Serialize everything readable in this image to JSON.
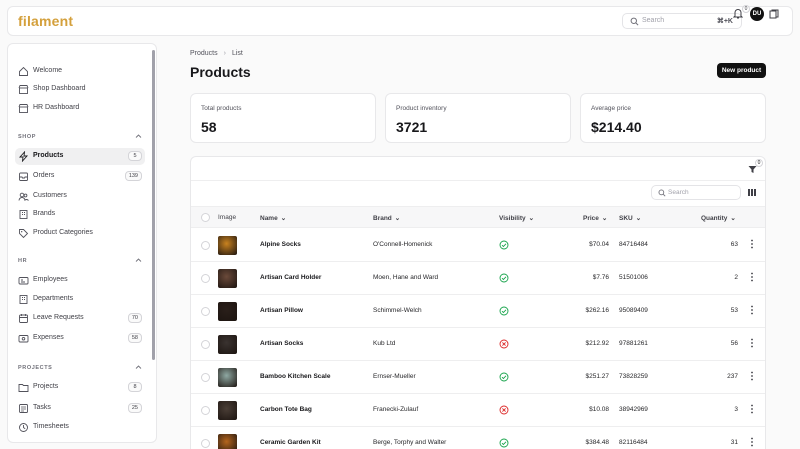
{
  "app": {
    "logo": "filament"
  },
  "topbar": {
    "search_placeholder": "Search",
    "search_shortcut": "⌘+K",
    "notifications_count": "0",
    "avatar_initials": "DU"
  },
  "sidebar": {
    "top_items": [
      {
        "label": "Welcome",
        "icon": "home-icon"
      },
      {
        "label": "Shop Dashboard",
        "icon": "shop-icon"
      },
      {
        "label": "HR Dashboard",
        "icon": "shop-icon"
      }
    ],
    "groups": [
      {
        "label": "SHOP",
        "items": [
          {
            "label": "Products",
            "count": "5",
            "active": true,
            "icon": "bolt-icon"
          },
          {
            "label": "Orders",
            "count": "139",
            "icon": "inbox-icon"
          },
          {
            "label": "Customers",
            "icon": "users-icon"
          },
          {
            "label": "Brands",
            "icon": "building-icon"
          },
          {
            "label": "Product Categories",
            "icon": "tag-icon"
          }
        ]
      },
      {
        "label": "HR",
        "items": [
          {
            "label": "Employees",
            "icon": "id-card-icon"
          },
          {
            "label": "Departments",
            "icon": "building-icon"
          },
          {
            "label": "Leave Requests",
            "count": "70",
            "icon": "calendar-icon"
          },
          {
            "label": "Expenses",
            "count": "58",
            "icon": "receipt-icon"
          }
        ]
      },
      {
        "label": "PROJECTS",
        "items": [
          {
            "label": "Projects",
            "count": "8",
            "icon": "folder-icon"
          },
          {
            "label": "Tasks",
            "count": "25",
            "icon": "list-icon"
          },
          {
            "label": "Timesheets",
            "icon": "clock-icon"
          }
        ]
      }
    ]
  },
  "breadcrumbs": [
    "Products",
    "List"
  ],
  "page": {
    "title": "Products",
    "new_button": "New product"
  },
  "stats": [
    {
      "label": "Total products",
      "value": "58"
    },
    {
      "label": "Product inventory",
      "value": "3721"
    },
    {
      "label": "Average price",
      "value": "$214.40"
    }
  ],
  "table": {
    "filter_count": "0",
    "search_placeholder": "Search",
    "columns": [
      "Image",
      "Name",
      "Brand",
      "Visibility",
      "Price",
      "SKU",
      "Quantity"
    ],
    "rows": [
      {
        "name": "Alpine Socks",
        "brand": "O'Connell-Homenick",
        "visible": true,
        "price": "$70.04",
        "sku": "84716484",
        "qty": "63",
        "thumb": "#c9821f"
      },
      {
        "name": "Artisan Card Holder",
        "brand": "Moen, Hane and Ward",
        "visible": true,
        "price": "$7.76",
        "sku": "51501006",
        "qty": "2",
        "thumb": "#6b4a3a"
      },
      {
        "name": "Artisan Pillow",
        "brand": "Schimmel-Welch",
        "visible": true,
        "price": "$262.16",
        "sku": "95089409",
        "qty": "53",
        "thumb": "#2a1f1a"
      },
      {
        "name": "Artisan Socks",
        "brand": "Kub Ltd",
        "visible": false,
        "price": "$212.92",
        "sku": "97881261",
        "qty": "56",
        "thumb": "#3a3330"
      },
      {
        "name": "Bamboo Kitchen Scale",
        "brand": "Ernser-Mueller",
        "visible": true,
        "price": "$251.27",
        "sku": "73828259",
        "qty": "237",
        "thumb": "#8fa9a3"
      },
      {
        "name": "Carbon Tote Bag",
        "brand": "Franecki-Zulauf",
        "visible": false,
        "price": "$10.08",
        "sku": "38942969",
        "qty": "3",
        "thumb": "#4a3e36"
      },
      {
        "name": "Ceramic Garden Kit",
        "brand": "Berge, Torphy and Walter",
        "visible": true,
        "price": "$384.48",
        "sku": "82116484",
        "qty": "31",
        "thumb": "#b5651d"
      }
    ]
  },
  "colors": {
    "accent": "#d4a03c",
    "success": "#16a34a",
    "danger": "#dc2626"
  }
}
